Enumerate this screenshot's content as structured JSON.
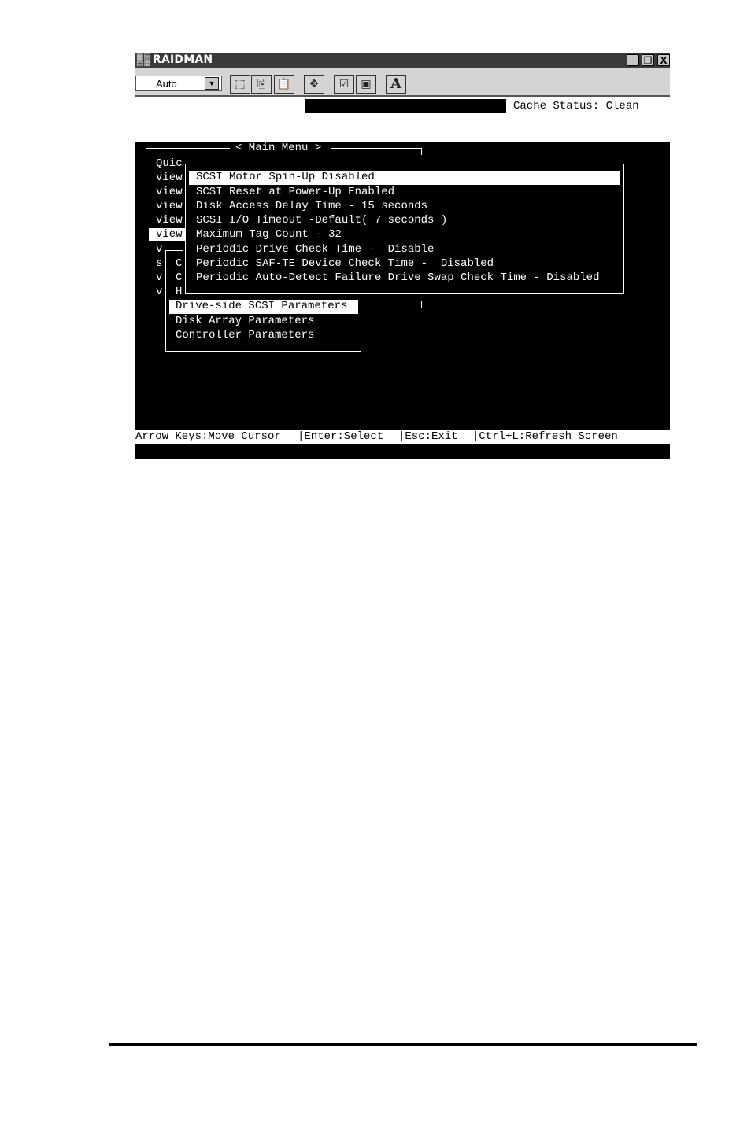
{
  "window": {
    "title": "RAIDMAN",
    "controls": {
      "minimize": "_",
      "restore": "❐",
      "close": "X"
    }
  },
  "toolbar": {
    "combo_value": "Auto",
    "buttons": [
      "mark-icon",
      "copy-icon",
      "paste-icon",
      "fullscreen-icon",
      "properties-icon",
      "background-icon",
      "font-icon"
    ],
    "font_label": "A"
  },
  "status": {
    "cache": "Cache Status: Clean"
  },
  "main_menu": {
    "title": "< Main Menu >",
    "items": [
      "Quic",
      "view",
      "view",
      "view",
      "view",
      "view",
      "v",
      "s",
      "v",
      "v"
    ],
    "partial_sub": [
      "C",
      "C",
      "H"
    ]
  },
  "config_menu": {
    "items": [
      "Drive-side SCSI Parameters",
      "Disk Array Parameters",
      "Controller Parameters"
    ]
  },
  "scsi_params": {
    "items": [
      "SCSI Motor Spin-Up Disabled",
      "SCSI Reset at Power-Up Enabled",
      "Disk Access Delay Time - 15 seconds",
      "SCSI I/O Timeout -Default( 7 seconds )",
      "Maximum Tag Count - 32",
      "Periodic Drive Check Time -  Disable",
      "Periodic SAF-TE Device Check Time -  Disabled",
      "Periodic Auto-Detect Failure Drive Swap Check Time - Disabled"
    ]
  },
  "keys": {
    "move": "Arrow Keys:Move Cursor",
    "select": "|Enter:Select",
    "exit": "|Esc:Exit",
    "refresh": "|Ctrl+L:Refresh Screen"
  }
}
